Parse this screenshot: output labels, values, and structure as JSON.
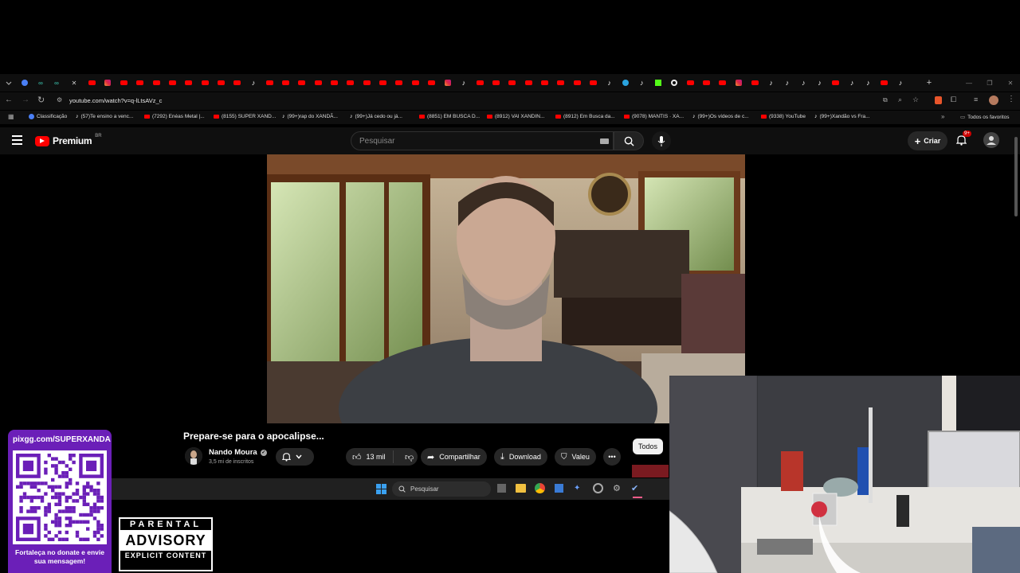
{
  "browser": {
    "url": "youtube.com/watch?v=q-lLtsAVz_c",
    "bookmarks": [
      "Classificação",
      "(57)Te ensino a venc...",
      "(7292) Enéas Metal |...",
      "(8155) SUPER XAND...",
      "(99+)rap do XANDÃ...",
      "(99+)Já cedo ou já...",
      "(8851) EM BUSCA D...",
      "(8912) VAI XANDIN...",
      "(8912) Em Busca da...",
      "(9078) MANTIS · XA...",
      "(99+)Os vídeos de c...",
      "(9338) YouTube",
      "(99+)Xandão vs Fra..."
    ],
    "all_bookmarks": "Todos os favoritos"
  },
  "youtube": {
    "logo": "Premium",
    "region": "BR",
    "search_placeholder": "Pesquisar",
    "create_label": "Criar",
    "notif_count": "9+",
    "video_title": "Prepare-se para o apocalipse...",
    "channel_name": "Nando Moura",
    "subscribers": "3,5 mi de inscritos",
    "likes": "13 mil",
    "share": "Compartilhar",
    "download": "Download",
    "thanks": "Valeu",
    "filter_all": "Todos"
  },
  "taskbar": {
    "search_placeholder": "Pesquisar"
  },
  "overlay": {
    "donate_handle": "pixgg.com/SUPERXANDA",
    "donate_text": "Fortaleça no donate e envie sua mensagem!",
    "advisory_top": "PARENTAL",
    "advisory_mid": "ADVISORY",
    "advisory_bottom": "EXPLICIT CONTENT"
  },
  "colors": {
    "youtube_red": "#ff0000",
    "dark_bg": "#0f0f0f",
    "pill_bg": "#272727",
    "donate_purple": "#7b2cbf"
  }
}
